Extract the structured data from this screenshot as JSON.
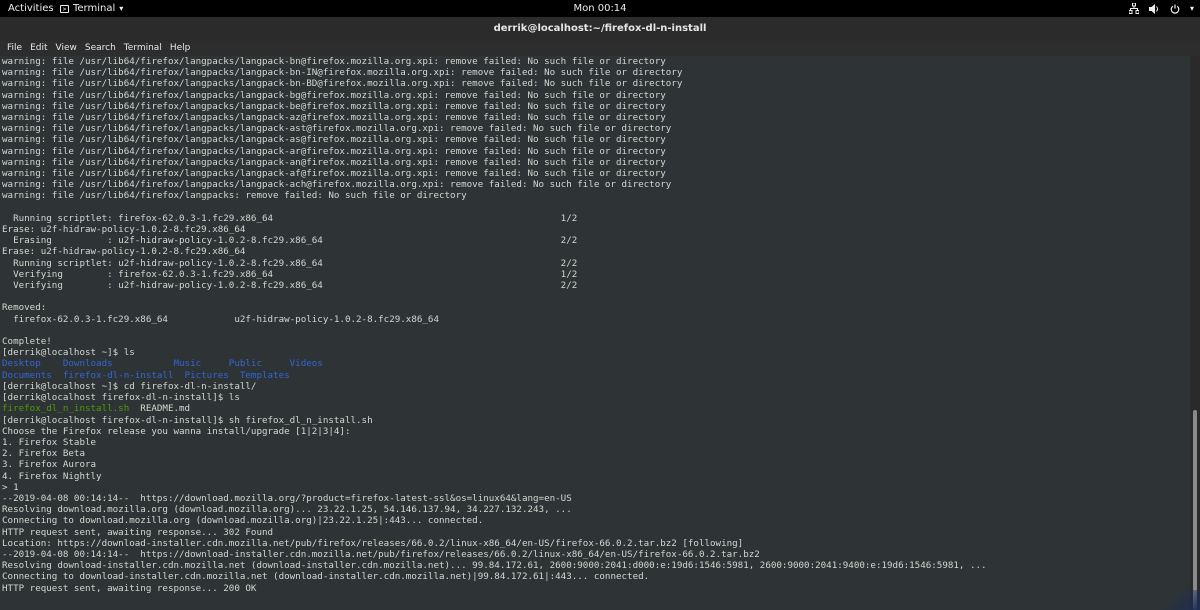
{
  "topbar": {
    "activities": "Activities",
    "app_name": "Terminal",
    "clock": "Mon 00:14"
  },
  "window": {
    "title": "derrik@localhost:~/firefox-dl-n-install"
  },
  "menu": [
    "File",
    "Edit",
    "View",
    "Search",
    "Terminal",
    "Help"
  ],
  "terminal": {
    "lines": [
      "warning: file /usr/lib64/firefox/langpacks/langpack-bn@firefox.mozilla.org.xpi: remove failed: No such file or directory",
      "warning: file /usr/lib64/firefox/langpacks/langpack-bn-IN@firefox.mozilla.org.xpi: remove failed: No such file or directory",
      "warning: file /usr/lib64/firefox/langpacks/langpack-bn-BD@firefox.mozilla.org.xpi: remove failed: No such file or directory",
      "warning: file /usr/lib64/firefox/langpacks/langpack-bg@firefox.mozilla.org.xpi: remove failed: No such file or directory",
      "warning: file /usr/lib64/firefox/langpacks/langpack-be@firefox.mozilla.org.xpi: remove failed: No such file or directory",
      "warning: file /usr/lib64/firefox/langpacks/langpack-az@firefox.mozilla.org.xpi: remove failed: No such file or directory",
      "warning: file /usr/lib64/firefox/langpacks/langpack-ast@firefox.mozilla.org.xpi: remove failed: No such file or directory",
      "warning: file /usr/lib64/firefox/langpacks/langpack-as@firefox.mozilla.org.xpi: remove failed: No such file or directory",
      "warning: file /usr/lib64/firefox/langpacks/langpack-ar@firefox.mozilla.org.xpi: remove failed: No such file or directory",
      "warning: file /usr/lib64/firefox/langpacks/langpack-an@firefox.mozilla.org.xpi: remove failed: No such file or directory",
      "warning: file /usr/lib64/firefox/langpacks/langpack-af@firefox.mozilla.org.xpi: remove failed: No such file or directory",
      "warning: file /usr/lib64/firefox/langpacks/langpack-ach@firefox.mozilla.org.xpi: remove failed: No such file or directory",
      "warning: file /usr/lib64/firefox/langpacks: remove failed: No such file or directory",
      "",
      "  Running scriptlet: firefox-62.0.3-1.fc29.x86_64                                                    1/2",
      "Erase: u2f-hidraw-policy-1.0.2-8.fc29.x86_64",
      "  Erasing          : u2f-hidraw-policy-1.0.2-8.fc29.x86_64                                           2/2",
      "Erase: u2f-hidraw-policy-1.0.2-8.fc29.x86_64",
      "  Running scriptlet: u2f-hidraw-policy-1.0.2-8.fc29.x86_64                                           2/2",
      "  Verifying        : firefox-62.0.3-1.fc29.x86_64                                                    1/2",
      "  Verifying        : u2f-hidraw-policy-1.0.2-8.fc29.x86_64                                           2/2",
      "",
      "Removed:",
      "  firefox-62.0.3-1.fc29.x86_64            u2f-hidraw-policy-1.0.2-8.fc29.x86_64",
      "",
      "Complete!",
      "[derrik@localhost ~]$ ls",
      "Desktop    Downloads           Music     Public     Videos",
      "Documents  firefox-dl-n-install  Pictures  Templates",
      "[derrik@localhost ~]$ cd firefox-dl-n-install/",
      "[derrik@localhost firefox-dl-n-install]$ ls",
      "firefox_dl_n_install.sh  README.md",
      "[derrik@localhost firefox-dl-n-install]$ sh firefox_dl_n_install.sh",
      "Choose the Firefox release you wanna install/upgrade [1|2|3|4]:",
      "1. Firefox Stable",
      "2. Firefox Beta",
      "3. Firefox Aurora",
      "4. Firefox Nightly",
      "> 1",
      "--2019-04-08 00:14:14--  https://download.mozilla.org/?product=firefox-latest-ssl&os=linux64&lang=en-US",
      "Resolving download.mozilla.org (download.mozilla.org)... 23.22.1.25, 54.146.137.94, 34.227.132.243, ...",
      "Connecting to download.mozilla.org (download.mozilla.org)|23.22.1.25|:443... connected.",
      "HTTP request sent, awaiting response... 302 Found",
      "Location: https://download-installer.cdn.mozilla.net/pub/firefox/releases/66.0.2/linux-x86_64/en-US/firefox-66.0.2.tar.bz2 [following]",
      "--2019-04-08 00:14:14--  https://download-installer.cdn.mozilla.net/pub/firefox/releases/66.0.2/linux-x86_64/en-US/firefox-66.0.2.tar.bz2",
      "Resolving download-installer.cdn.mozilla.net (download-installer.cdn.mozilla.net)... 99.84.172.61, 2600:9000:2041:d000:e:19d6:1546:5981, 2600:9000:2041:9400:e:19d6:1546:5981, ...",
      "Connecting to download-installer.cdn.mozilla.net (download-installer.cdn.mozilla.net)|99.84.172.61|:443... connected.",
      "HTTP request sent, awaiting response... 200 OK"
    ],
    "colored": {
      "27": "blue",
      "28": "blue",
      "31": "green-first"
    }
  },
  "icons": {
    "network": "network-icon",
    "volume": "volume-icon",
    "power": "power-icon",
    "app": "terminal-icon"
  },
  "colors": {
    "terminal_bg": "#2e3436",
    "terminal_fg": "#d3d7cf",
    "dir_blue": "#3465d4",
    "exec_green": "#4e9a06"
  }
}
